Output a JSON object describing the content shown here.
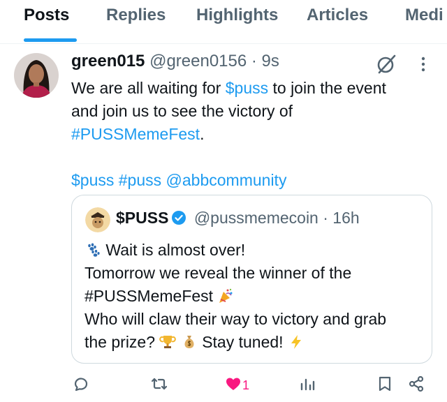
{
  "tabs": [
    "Posts",
    "Replies",
    "Highlights",
    "Articles",
    "Medi"
  ],
  "post": {
    "author_name": "green015",
    "author_handle": "@green0156",
    "time": "· 9s",
    "lines": [
      [
        {
          "t": "We are all waiting for "
        },
        {
          "t": "$puss",
          "link": true
        },
        {
          "t": " to join the event"
        }
      ],
      [
        {
          "t": "and join us to see the victory of"
        }
      ],
      [
        {
          "t": "#PUSSMemeFest",
          "link": true
        },
        {
          "t": "."
        }
      ],
      [
        {
          "t": " "
        }
      ],
      [
        {
          "t": "$puss #puss @abbcommunity",
          "link": true
        }
      ]
    ]
  },
  "quote": {
    "name": "$PUSS",
    "handle": "@pussmemecoin",
    "time": "· 16h",
    "line1": "Wait is almost over!",
    "line2": "Tomorrow we reveal the winner of the",
    "line3": "#PUSSMemeFest",
    "line4": "Who will claw their way to victory and grab",
    "line5a": "the prize?",
    "line5b": "Stay tuned!"
  },
  "actions": {
    "likes": "1"
  },
  "colors": {
    "accent": "#1d9bf0",
    "like": "#f91880",
    "muted": "#536471"
  }
}
